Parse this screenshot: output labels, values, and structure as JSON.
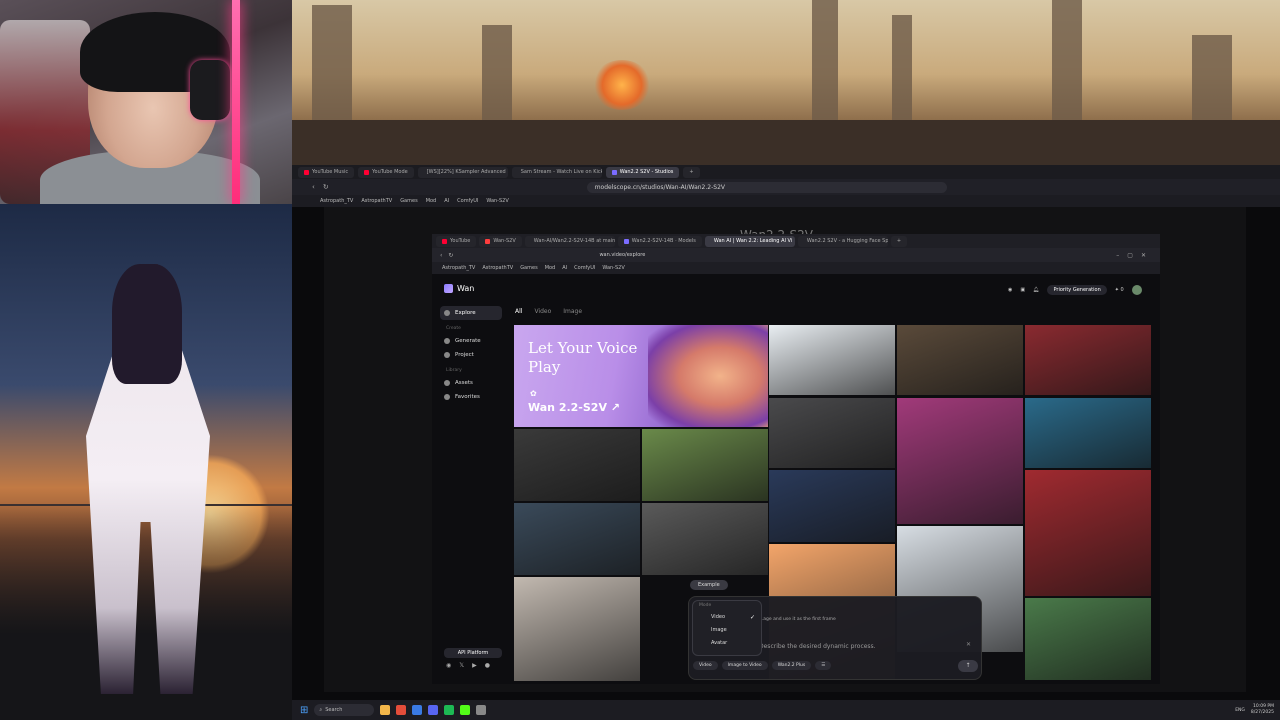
{
  "outer_browser": {
    "tabs": [
      {
        "label": "YouTube Music",
        "color": "#ff0033"
      },
      {
        "label": "YouTube Mode",
        "color": "#ff0033"
      },
      {
        "label": "[WS][22%] KSampler Advanced",
        "color": "#555555"
      },
      {
        "label": "Sam Stream - Watch Live on Kick",
        "color": "#53fc18"
      },
      {
        "label": "Wan2.2 S2V - Studios",
        "color": "#7b6cff",
        "active": true
      }
    ],
    "url": "modelscope.cn/studios/Wan-AI/Wan2.2-S2V",
    "bookmarks": [
      "Astropath_TV",
      "AstropathTV",
      "Games",
      "Mod",
      "AI",
      "ComfyUI",
      "Wan-S2V"
    ],
    "page_title": "Wan2.2-S2V"
  },
  "inner_browser": {
    "tabs": [
      {
        "label": "YouTube",
        "color": "#ff0033"
      },
      {
        "label": "Wan-S2V",
        "color": "#ff3d3d"
      },
      {
        "label": "Wan-AI/Wan2.2-S2V-14B at main",
        "color": "#ffcc33"
      },
      {
        "label": "Wan2.2-S2V-14B · Models",
        "color": "#7b6cff"
      },
      {
        "label": "Wan AI | Wan 2.2: Leading AI Vi",
        "color": "#7b6cff",
        "active": true
      },
      {
        "label": "Wan2.2 S2V - a Hugging Face Space",
        "color": "#ffcc33"
      }
    ],
    "url": "wan.video/explore",
    "bookmarks": [
      "Astropath_TV",
      "AstropathTV",
      "Games",
      "Mod",
      "AI",
      "ComfyUI",
      "Wan-S2V"
    ]
  },
  "wan": {
    "logo": "Wan",
    "sidebar": {
      "explore": "Explore",
      "create_section": "Create",
      "generate": "Generate",
      "project": "Project",
      "library_section": "Library",
      "assets": "Assets",
      "favorites": "Favorites",
      "api_button": "API Platform",
      "socials": [
        "discord",
        "x",
        "youtube",
        "github"
      ]
    },
    "filters": [
      "All",
      "Video",
      "Image"
    ],
    "active_filter": "All",
    "top": {
      "priority": "Priority Generation",
      "credits": "0"
    },
    "hero": {
      "title": "Let Your Voice Play",
      "subtitle": "Wan 2.2-S2V ↗"
    },
    "gallery_tiles": [
      {
        "label": "snow-curve",
        "color": "#e9eef2"
      },
      {
        "label": "gondola-street",
        "color": "#5a4a3a"
      },
      {
        "label": "red-alley-man",
        "color": "#8a2a30"
      },
      {
        "label": "airport-walkers",
        "color": "#3a3a3a"
      },
      {
        "label": "glass-face",
        "color": "#6a8a4a"
      },
      {
        "label": "dancer-in-rain",
        "color": "#4a4a4c"
      },
      {
        "label": "neon-girl",
        "color": "#a13a7a"
      },
      {
        "label": "aquarium-couple",
        "color": "#2a6a8a"
      },
      {
        "label": "coastal-road",
        "color": "#3a4a5a"
      },
      {
        "label": "umbrella-couple",
        "color": "#5a5a5a"
      },
      {
        "label": "umbrella-city",
        "color": "#2a3a5a"
      },
      {
        "label": "snow-girl",
        "color": "#a02a30"
      },
      {
        "label": "smiling-man",
        "color": "#f3a56a"
      },
      {
        "label": "snow-forest",
        "color": "#d7dde3"
      },
      {
        "label": "mountain-head",
        "color": "#c2b9b0"
      },
      {
        "label": "valley",
        "color": "#4a7a4a"
      }
    ],
    "prompt": {
      "example_chip": "Example",
      "hint": "...age and use it as the first frame",
      "placeholder": "Describe the desired dynamic process.",
      "mode_menu": {
        "header": "Mode",
        "items": [
          "Video",
          "Image",
          "Avatar"
        ],
        "selected": "Video"
      },
      "chips": [
        "Video",
        "Image to Video",
        "Wan2.2 Plus",
        "☰"
      ],
      "send_label": "↑"
    }
  },
  "taskbar": {
    "search": "Search",
    "lang": "ENG",
    "time": "10:09 PM",
    "date": "8/27/2025"
  }
}
